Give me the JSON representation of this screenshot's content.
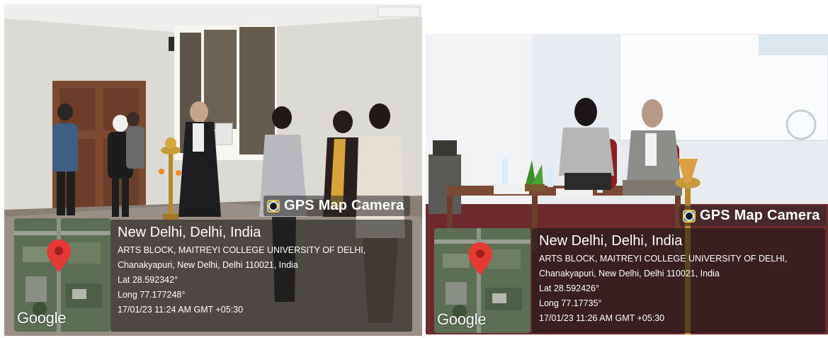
{
  "photos": [
    {
      "gps_badge": "GPS Map Camera",
      "city": "New Delhi, Delhi, India",
      "address_line1": "ARTS BLOCK, MAITREYI COLLEGE UNIVERSITY OF DELHI,",
      "address_line2": "Chanakyapuri, New Delhi, Delhi 110021, India",
      "lat": "Lat 28.592342°",
      "long": "Long 77.177248°",
      "datetime": "17/01/23 11:24 AM GMT +05:30",
      "map_label": "Google",
      "icons": [
        "camera-app-icon",
        "map-pin-icon"
      ]
    },
    {
      "gps_badge": "GPS Map Camera",
      "city": "New Delhi, Delhi, India",
      "address_line1": "ARTS BLOCK, MAITREYI COLLEGE UNIVERSITY OF DELHI,",
      "address_line2": "Chanakyapuri, New Delhi, Delhi 110021, India",
      "lat": "Lat 28.592426°",
      "long": "Long 77.17735°",
      "datetime": "17/01/23 11:26 AM GMT +05:30",
      "map_label": "Google",
      "icons": [
        "camera-app-icon",
        "map-pin-icon"
      ]
    }
  ],
  "colors": {
    "pin_red": "#e53935",
    "overlay_dark": "#191919",
    "wall_left": "#dcdad5",
    "floor_left": "#8a7f75",
    "carpet_right": "#6b2a2e",
    "wall_right": "#e9ecef"
  }
}
